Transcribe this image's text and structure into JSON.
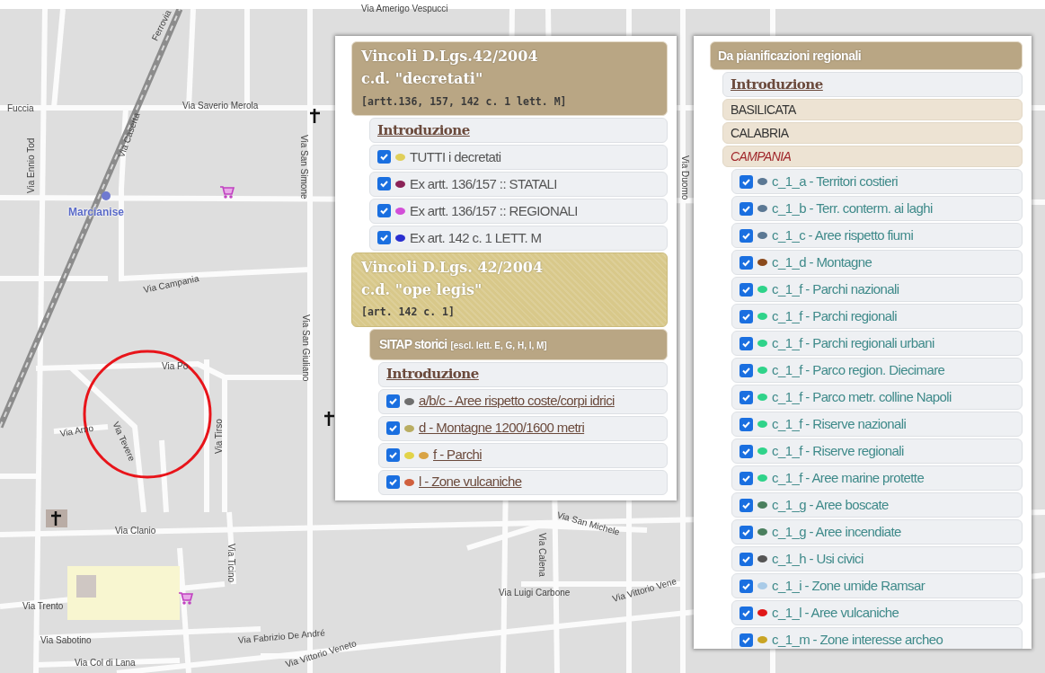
{
  "map": {
    "labels": [
      {
        "kind": "street",
        "text": "Via Amerigo Vespucci"
      },
      {
        "kind": "street",
        "text": "Ferrovia"
      },
      {
        "kind": "street",
        "text": "Fuccia"
      },
      {
        "kind": "street",
        "text": "Via Saverio Merola"
      },
      {
        "kind": "street",
        "text": "Via Ennio Tod"
      },
      {
        "kind": "street",
        "text": "Via Caserta"
      },
      {
        "kind": "town",
        "text": "Marcianise"
      },
      {
        "kind": "street",
        "text": "Via Campania"
      },
      {
        "kind": "street",
        "text": "Via San Simone"
      },
      {
        "kind": "street",
        "text": "Via San Giuliano"
      },
      {
        "kind": "street",
        "text": "Via Po"
      },
      {
        "kind": "street",
        "text": "Via Arno"
      },
      {
        "kind": "street",
        "text": "Via Tevere"
      },
      {
        "kind": "street",
        "text": "Via Tirso"
      },
      {
        "kind": "street",
        "text": "Via Clanio"
      },
      {
        "kind": "street",
        "text": "Via Ticino"
      },
      {
        "kind": "street",
        "text": "Via Trento"
      },
      {
        "kind": "street",
        "text": "Via Sabotino"
      },
      {
        "kind": "street",
        "text": "Via Col di Lana"
      },
      {
        "kind": "street",
        "text": "Via Fabrizio De André"
      },
      {
        "kind": "street",
        "text": "Via Vittorio Veneto"
      },
      {
        "kind": "street",
        "text": "Via San Michele"
      },
      {
        "kind": "street",
        "text": "Via Calena"
      },
      {
        "kind": "street",
        "text": "Via Luigi Carbone"
      },
      {
        "kind": "street",
        "text": "Via Vittorio Vene"
      },
      {
        "kind": "street",
        "text": "Via Duomo"
      }
    ]
  },
  "panels": [
    {
      "rows": [
        {
          "kind": "group",
          "highlighted": false,
          "title_lines": [
            "Vincoli D.Lgs.42/2004",
            "c.d. \"decretati\""
          ],
          "note": "[artt.136, 157, 142 c. 1 lett. M]",
          "children": [
            {
              "kind": "intro",
              "label": "Introduzione"
            },
            {
              "kind": "layer",
              "checked": true,
              "dots": [
                {
                  "color": "#e0cf5a"
                }
              ],
              "label": "TUTTI i decretati"
            },
            {
              "kind": "layer",
              "checked": true,
              "dots": [
                {
                  "color": "#8b2257"
                }
              ],
              "label": "Ex artt. 136/157 :: STATALI"
            },
            {
              "kind": "layer",
              "checked": true,
              "dots": [
                {
                  "color": "#d24ed8"
                }
              ],
              "label": "Ex artt. 136/157 :: REGIONALI"
            },
            {
              "kind": "layer",
              "checked": true,
              "dots": [
                {
                  "color": "#2a2fd0"
                }
              ],
              "label": "Ex art. 142 c. 1 LETT. M"
            }
          ]
        },
        {
          "kind": "group",
          "highlighted": true,
          "title_lines": [
            "Vincoli D.Lgs. 42/2004",
            "c.d. \"ope legis\""
          ],
          "note": "[art. 142 c. 1]",
          "children": [
            {
              "kind": "subgroup",
              "title": "SITAP storici",
              "note": "[escl. lett. E, G, H, I, M]",
              "children": [
                {
                  "kind": "intro",
                  "label": "Introduzione"
                },
                {
                  "kind": "link-layer",
                  "checked": true,
                  "dots": [
                    {
                      "color": "#6e6e6e"
                    }
                  ],
                  "label": "a/b/c - Aree rispetto coste/corpi idrici"
                },
                {
                  "kind": "link-layer",
                  "checked": true,
                  "dots": [
                    {
                      "color": "#b9ad62"
                    }
                  ],
                  "label": "d - Montagne 1200/1600 metri"
                },
                {
                  "kind": "link-layer",
                  "checked": true,
                  "dots": [
                    {
                      "color": "#e2d348"
                    },
                    {
                      "color": "#d9a446"
                    }
                  ],
                  "label": "f - Parchi"
                },
                {
                  "kind": "link-layer",
                  "checked": true,
                  "dots": [
                    {
                      "color": "#d0603e"
                    }
                  ],
                  "label": "l - Zone vulcaniche"
                }
              ]
            }
          ]
        }
      ]
    },
    {
      "rows": [
        {
          "kind": "group",
          "highlighted": false,
          "title_lines": [
            "Da pianificazioni regionali"
          ],
          "children": [
            {
              "kind": "intro",
              "label": "Introduzione"
            },
            {
              "kind": "region",
              "expanded": false,
              "label": "BASILICATA"
            },
            {
              "kind": "region",
              "expanded": false,
              "label": "CALABRIA"
            },
            {
              "kind": "region",
              "expanded": true,
              "label": "CAMPANIA",
              "children": [
                {
                  "kind": "layer",
                  "checked": true,
                  "dots": [
                    {
                      "color": "#5b7894"
                    }
                  ],
                  "label": "c_1_a - Territori costieri"
                },
                {
                  "kind": "layer",
                  "checked": true,
                  "dots": [
                    {
                      "color": "#5b7894"
                    }
                  ],
                  "label": "c_1_b - Terr. conterm. ai laghi"
                },
                {
                  "kind": "layer",
                  "checked": true,
                  "dots": [
                    {
                      "color": "#5b7894"
                    }
                  ],
                  "label": "c_1_c - Aree rispetto fiumi"
                },
                {
                  "kind": "layer",
                  "checked": true,
                  "dots": [
                    {
                      "color": "#8b4a1c"
                    }
                  ],
                  "label": "c_1_d - Montagne"
                },
                {
                  "kind": "layer",
                  "checked": true,
                  "dots": [
                    {
                      "color": "#2fd38a"
                    }
                  ],
                  "label": "c_1_f - Parchi nazionali"
                },
                {
                  "kind": "layer",
                  "checked": true,
                  "dots": [
                    {
                      "color": "#2fd38a"
                    }
                  ],
                  "label": "c_1_f - Parchi regionali"
                },
                {
                  "kind": "layer",
                  "checked": true,
                  "dots": [
                    {
                      "color": "#2fd38a"
                    }
                  ],
                  "label": "c_1_f - Parchi regionali urbani"
                },
                {
                  "kind": "layer",
                  "checked": true,
                  "dots": [
                    {
                      "color": "#2fd38a"
                    }
                  ],
                  "label": "c_1_f - Parco region. Diecimare"
                },
                {
                  "kind": "layer",
                  "checked": true,
                  "dots": [
                    {
                      "color": "#2fd38a"
                    }
                  ],
                  "label": "c_1_f - Parco metr. colline Napoli"
                },
                {
                  "kind": "layer",
                  "checked": true,
                  "dots": [
                    {
                      "color": "#2fd38a"
                    }
                  ],
                  "label": "c_1_f - Riserve nazionali"
                },
                {
                  "kind": "layer",
                  "checked": true,
                  "dots": [
                    {
                      "color": "#2fd38a"
                    }
                  ],
                  "label": "c_1_f - Riserve regionali"
                },
                {
                  "kind": "layer",
                  "checked": true,
                  "dots": [
                    {
                      "color": "#2fd38a"
                    }
                  ],
                  "label": "c_1_f - Aree marine protette"
                },
                {
                  "kind": "layer",
                  "checked": true,
                  "dots": [
                    {
                      "color": "#4a7f5e"
                    }
                  ],
                  "label": "c_1_g - Aree boscate"
                },
                {
                  "kind": "layer",
                  "checked": true,
                  "dots": [
                    {
                      "color": "#4a7f5e"
                    }
                  ],
                  "label": "c_1_g - Aree incendiate"
                },
                {
                  "kind": "layer",
                  "checked": true,
                  "dots": [
                    {
                      "color": "#555555"
                    }
                  ],
                  "label": "c_1_h - Usi civici"
                },
                {
                  "kind": "layer",
                  "checked": true,
                  "dots": [
                    {
                      "color": "#a9cbe8"
                    }
                  ],
                  "label": "c_1_i - Zone umide Ramsar"
                },
                {
                  "kind": "layer",
                  "checked": true,
                  "dots": [
                    {
                      "color": "#e01818"
                    }
                  ],
                  "label": "c_1_l - Aree vulcaniche"
                },
                {
                  "kind": "layer",
                  "checked": true,
                  "dots": [
                    {
                      "color": "#c9a424"
                    }
                  ],
                  "label": "c_1_m - Zone interesse archeo"
                }
              ]
            }
          ]
        }
      ]
    }
  ]
}
